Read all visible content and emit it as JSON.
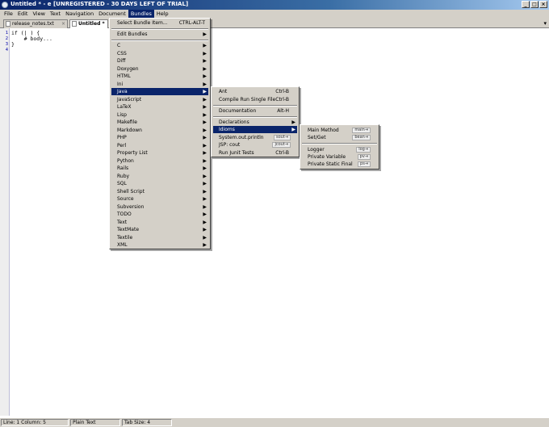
{
  "window": {
    "title": "Untitled * - e [UNREGISTERED - 30 DAYS LEFT OF TRIAL]",
    "minimize": "_",
    "maximize": "□",
    "close": "×"
  },
  "menubar": [
    "File",
    "Edit",
    "View",
    "Text",
    "Navigation",
    "Document",
    "Bundles",
    "Help"
  ],
  "tabs": {
    "items": [
      "release_notes.txt",
      "Untitled *"
    ],
    "close_glyph": "×",
    "chevron": "▾"
  },
  "editor": {
    "line_numbers": [
      "1",
      "2",
      "3",
      "4"
    ],
    "lines": [
      "if (| ) {",
      "    # body...",
      "}",
      ""
    ]
  },
  "bundles_menu": {
    "select_item": {
      "label": "Select Bundle Item...",
      "shortcut": "CTRL-ALT-T"
    },
    "edit_bundles": "Edit Bundles",
    "items": [
      "C",
      "CSS",
      "Diff",
      "Doxygen",
      "HTML",
      "Ini",
      "Java",
      "JavaScript",
      "LaTeX",
      "Lisp",
      "Makefile",
      "Markdown",
      "PHP",
      "Perl",
      "Property List",
      "Python",
      "Rails",
      "Ruby",
      "SQL",
      "Shell Script",
      "Source",
      "Subversion",
      "TODO",
      "Text",
      "TextMate",
      "Textile",
      "XML"
    ],
    "highlighted": "Java"
  },
  "java_menu": {
    "items": [
      {
        "label": "Ant",
        "shortcut": "Ctrl-B"
      },
      {
        "label": "Compile Run Single File",
        "shortcut": "Ctrl-B"
      },
      {
        "label": "Documentation",
        "shortcut": "Alt-H"
      },
      {
        "label": "Declarations",
        "shortcut": ""
      },
      {
        "label": "Idioms",
        "shortcut": ""
      },
      {
        "label": "System.out.println",
        "trigger": "sout⇥"
      },
      {
        "label": "JSP: cout",
        "trigger": "jcout⇥"
      },
      {
        "label": "Run Junit Tests",
        "shortcut": "Ctrl-B"
      }
    ]
  },
  "idioms_menu": {
    "items": [
      {
        "label": "Main Method",
        "trigger": "main⇥"
      },
      {
        "label": "Set/Get",
        "trigger": "bean⇥"
      },
      {
        "label": "Logger",
        "trigger": "log⇥"
      },
      {
        "label": "Private Variable",
        "trigger": "pv⇥"
      },
      {
        "label": "Private Static Final",
        "trigger": "ps⇥"
      }
    ]
  },
  "statusbar": {
    "position": "Line: 1  Column: 5",
    "mode": "Plain Text",
    "tab_size": "Tab Size: 4"
  },
  "submenu_arrow": "▶"
}
